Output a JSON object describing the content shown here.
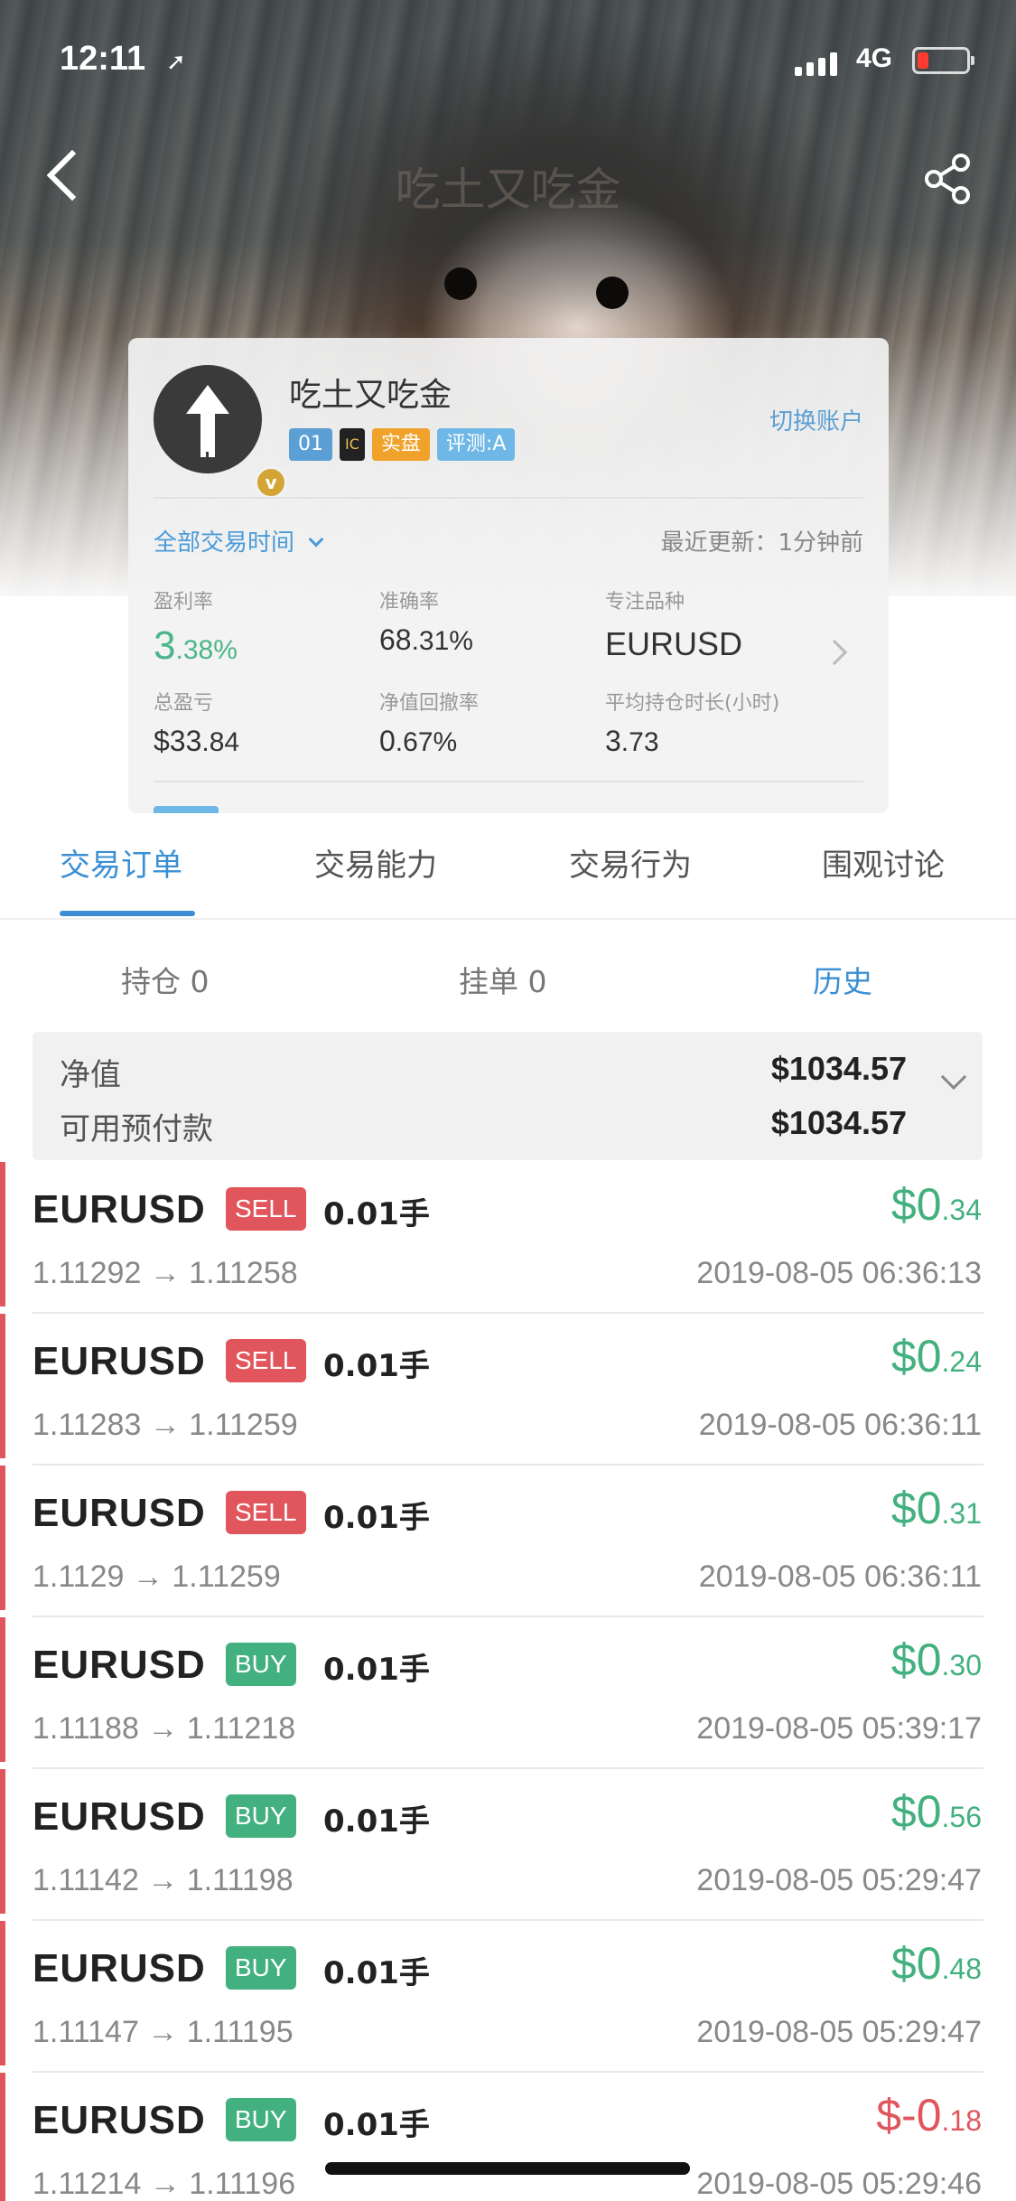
{
  "status": {
    "time": "12:11",
    "network": "4G"
  },
  "nav": {
    "title": "吃土又吃金"
  },
  "profile": {
    "name": "吃土又吃金",
    "badges": {
      "level": "01",
      "broker": "IC",
      "real": "实盘",
      "rating": "评测:A"
    },
    "switch_account": "切换账户",
    "time_filter": "全部交易时间",
    "last_update": "最近更新：1分钟前",
    "stats": [
      {
        "label": "盈利率",
        "value_main": "3",
        "value_small": ".38%"
      },
      {
        "label": "准确率",
        "value_main": "68",
        "value_small": ".31%"
      },
      {
        "label": "专注品种",
        "value_main": "EURUSD",
        "value_small": ""
      },
      {
        "label": "总盈亏",
        "value_main": "$33",
        "value_small": ".84"
      },
      {
        "label": "净值回撤率",
        "value_main": "0",
        "value_small": ".67%"
      },
      {
        "label": "平均持仓时长(小时)",
        "value_main": "3",
        "value_small": ".73"
      }
    ]
  },
  "tabs": [
    "交易订单",
    "交易能力",
    "交易行为",
    "围观讨论"
  ],
  "subtabs": [
    "持仓 0",
    "挂单 0",
    "历史"
  ],
  "summary": {
    "equity_label": "净值",
    "equity_value": "$1034.57",
    "margin_label": "可用预付款",
    "margin_value": "$1034.57"
  },
  "orders": [
    {
      "symbol": "EURUSD",
      "side": "SELL",
      "lots": "0.01手",
      "profit_main": "$0",
      "profit_small": ".34",
      "prices": "1.11292 → 1.11258",
      "time": "2019-08-05 06:36:13"
    },
    {
      "symbol": "EURUSD",
      "side": "SELL",
      "lots": "0.01手",
      "profit_main": "$0",
      "profit_small": ".24",
      "prices": "1.11283 → 1.11259",
      "time": "2019-08-05 06:36:11"
    },
    {
      "symbol": "EURUSD",
      "side": "SELL",
      "lots": "0.01手",
      "profit_main": "$0",
      "profit_small": ".31",
      "prices": "1.1129 → 1.11259",
      "time": "2019-08-05 06:36:11"
    },
    {
      "symbol": "EURUSD",
      "side": "BUY",
      "lots": "0.01手",
      "profit_main": "$0",
      "profit_small": ".30",
      "prices": "1.11188 → 1.11218",
      "time": "2019-08-05 05:39:17"
    },
    {
      "symbol": "EURUSD",
      "side": "BUY",
      "lots": "0.01手",
      "profit_main": "$0",
      "profit_small": ".56",
      "prices": "1.11142 → 1.11198",
      "time": "2019-08-05 05:29:47"
    },
    {
      "symbol": "EURUSD",
      "side": "BUY",
      "lots": "0.01手",
      "profit_main": "$0",
      "profit_small": ".48",
      "prices": "1.11147 → 1.11195",
      "time": "2019-08-05 05:29:47"
    },
    {
      "symbol": "EURUSD",
      "side": "BUY",
      "lots": "0.01手",
      "profit_main": "$-0",
      "profit_small": ".18",
      "prices": "1.11214 → 1.11196",
      "time": "2019-08-05 05:29:46"
    }
  ],
  "colors": {
    "accent": "#3a8fd4",
    "profit": "#43b07f",
    "loss": "#e0565c"
  }
}
